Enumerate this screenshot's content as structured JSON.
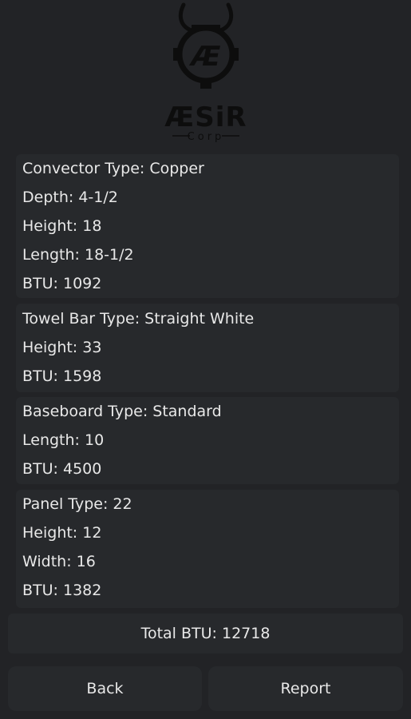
{
  "logo": {
    "wordmark": "ÆSiR",
    "subtext": "Corp"
  },
  "cards": [
    {
      "lines": [
        "Convector Type: Copper",
        "Depth: 4-1/2",
        "Height: 18",
        "Length: 18-1/2",
        "BTU: 1092"
      ]
    },
    {
      "lines": [
        "Towel Bar Type: Straight White",
        "Height: 33",
        "BTU: 1598"
      ]
    },
    {
      "lines": [
        "Baseboard Type: Standard",
        "Length: 10",
        "BTU: 4500"
      ]
    },
    {
      "lines": [
        "Panel Type: 22",
        "Height: 12",
        "Width: 16",
        "BTU: 1382"
      ]
    }
  ],
  "total": {
    "label": "Total BTU: 12718"
  },
  "buttons": {
    "back": "Back",
    "report": "Report"
  },
  "colors": {
    "background": "#222326",
    "card": "#27292c",
    "text": "#e8e8e8",
    "logo": "#0d0d0d"
  }
}
